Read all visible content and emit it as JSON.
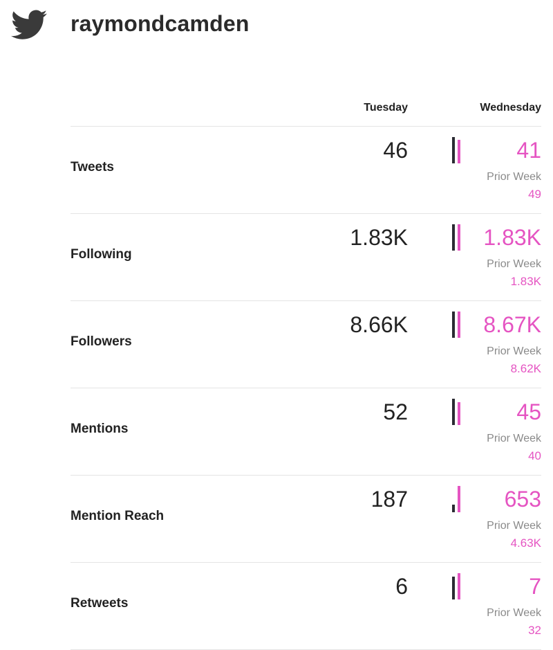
{
  "header": {
    "icon": "twitter-bird-icon",
    "username": "raymondcamden"
  },
  "columns": {
    "tuesday": "Tuesday",
    "wednesday": "Wednesday"
  },
  "colors": {
    "accent": "#e554c2",
    "previous_bar": "#2b2b33",
    "muted": "#8a8a8a",
    "logo": "#3a3a3a"
  },
  "rows": [
    {
      "label": "Tweets",
      "tuesday": "46",
      "wednesday": "41",
      "prior_label": "Prior Week",
      "prior": "49",
      "tuesday_num": 46,
      "wednesday_num": 41
    },
    {
      "label": "Following",
      "tuesday": "1.83K",
      "wednesday": "1.83K",
      "prior_label": "Prior Week",
      "prior": "1.83K",
      "tuesday_num": 1830,
      "wednesday_num": 1830
    },
    {
      "label": "Followers",
      "tuesday": "8.66K",
      "wednesday": "8.67K",
      "prior_label": "Prior Week",
      "prior": "8.62K",
      "tuesday_num": 8660,
      "wednesday_num": 8670
    },
    {
      "label": "Mentions",
      "tuesday": "52",
      "wednesday": "45",
      "prior_label": "Prior Week",
      "prior": "40",
      "tuesday_num": 52,
      "wednesday_num": 45
    },
    {
      "label": "Mention Reach",
      "tuesday": "187",
      "wednesday": "653",
      "prior_label": "Prior Week",
      "prior": "4.63K",
      "tuesday_num": 187,
      "wednesday_num": 653
    },
    {
      "label": "Retweets",
      "tuesday": "6",
      "wednesday": "7",
      "prior_label": "Prior Week",
      "prior": "32",
      "tuesday_num": 6,
      "wednesday_num": 7
    }
  ]
}
